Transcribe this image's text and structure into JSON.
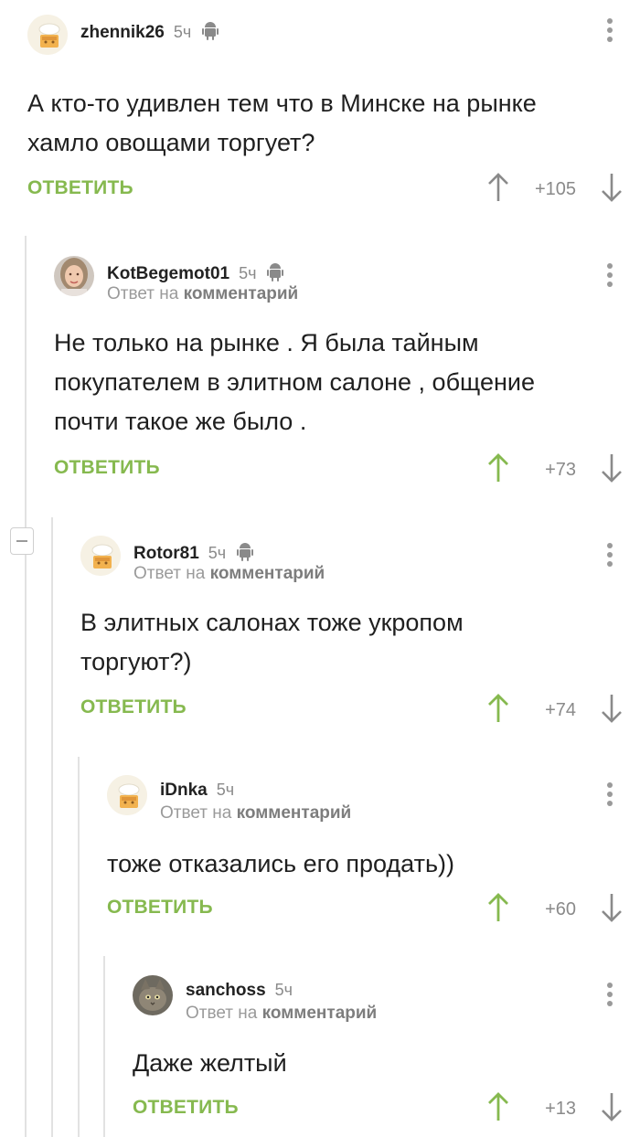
{
  "reply_label": "ОТВЕТИТЬ",
  "reply_to_prefix": "Ответ на",
  "reply_to_link": "комментарий",
  "colors": {
    "accent_green": "#86b94f",
    "muted_gray": "#8a8a8a"
  },
  "comments": [
    {
      "author": "zhennik26",
      "time": "5ч",
      "platform_icon": "android-icon",
      "avatar": "default-avatar",
      "text": [
        "А кто-то удивлен тем что в Минске на рынке",
        "хамло овощами торгует?"
      ],
      "score": "+105",
      "upvoted": false
    },
    {
      "author": "KotBegemot01",
      "time": "5ч",
      "platform_icon": "android-icon",
      "avatar": "user-photo-avatar",
      "text": [
        "Не только на рынке . Я была тайным",
        "покупателем в элитном салоне , общение",
        "почти такое же было ."
      ],
      "score": "+73",
      "upvoted": true
    },
    {
      "author": "Rotor81",
      "time": "5ч",
      "platform_icon": "android-icon",
      "avatar": "default-avatar",
      "text": [
        "В элитных салонах тоже укропом",
        "торгуют?)"
      ],
      "score": "+74",
      "upvoted": true
    },
    {
      "author": "iDnka",
      "time": "5ч",
      "avatar": "default-avatar",
      "text": [
        "тоже отказались его продать))"
      ],
      "score": "+60",
      "upvoted": true
    },
    {
      "author": "sanchoss",
      "time": "5ч",
      "avatar": "cat-photo-avatar",
      "text": [
        "Даже желтый"
      ],
      "score": "+13",
      "upvoted": true
    }
  ]
}
